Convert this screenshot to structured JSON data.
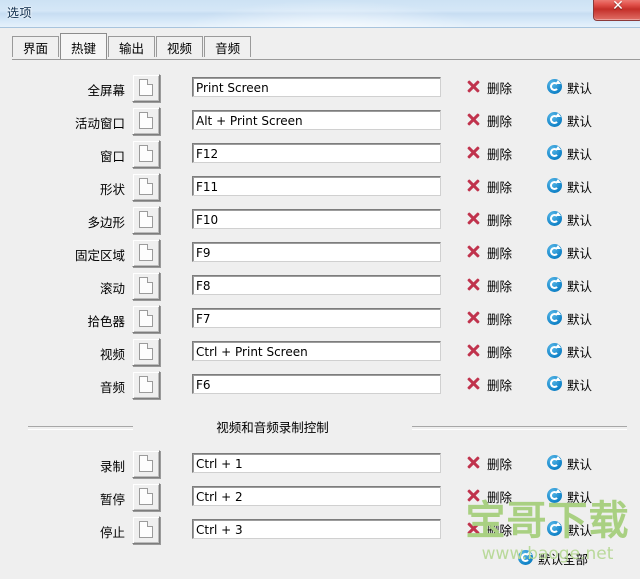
{
  "window": {
    "title": "选项",
    "close_label": "✕",
    "close_icon": "close-icon"
  },
  "tabs": [
    {
      "label": "界面",
      "active": false
    },
    {
      "label": "热键",
      "active": true
    },
    {
      "label": "输出",
      "active": false
    },
    {
      "label": "视频",
      "active": false
    },
    {
      "label": "音频",
      "active": false
    }
  ],
  "actions": {
    "delete_label": "删除",
    "delete_icon": "red-x-icon",
    "default_label": "默认",
    "default_icon": "blue-refresh-icon",
    "default_all_label": "默认全部",
    "picker_icon": "document-page-icon"
  },
  "hotkeys": [
    {
      "label": "全屏幕",
      "value": "Print Screen"
    },
    {
      "label": "活动窗口",
      "value": "Alt + Print Screen"
    },
    {
      "label": "窗口",
      "value": "F12"
    },
    {
      "label": "形状",
      "value": "F11"
    },
    {
      "label": "多边形",
      "value": "F10"
    },
    {
      "label": "固定区域",
      "value": "F9"
    },
    {
      "label": "滚动",
      "value": "F8"
    },
    {
      "label": "拾色器",
      "value": "F7"
    },
    {
      "label": "视频",
      "value": "Ctrl + Print Screen"
    },
    {
      "label": "音频",
      "value": "F6"
    }
  ],
  "section": {
    "title": "视频和音频录制控制"
  },
  "recording_hotkeys": [
    {
      "label": "录制",
      "value": "Ctrl + 1"
    },
    {
      "label": "暂停",
      "value": "Ctrl + 2"
    },
    {
      "label": "停止",
      "value": "Ctrl + 3"
    }
  ],
  "watermark": {
    "text": "宝哥下载",
    "url": "www.baoge.net"
  },
  "colors": {
    "titlebar": "#cde2f4",
    "close_button": "#c42f29",
    "delete_icon": "#c0334d",
    "default_icon": "#1183c8",
    "watermark": "#a9d082",
    "page_bg": "#efefef"
  }
}
